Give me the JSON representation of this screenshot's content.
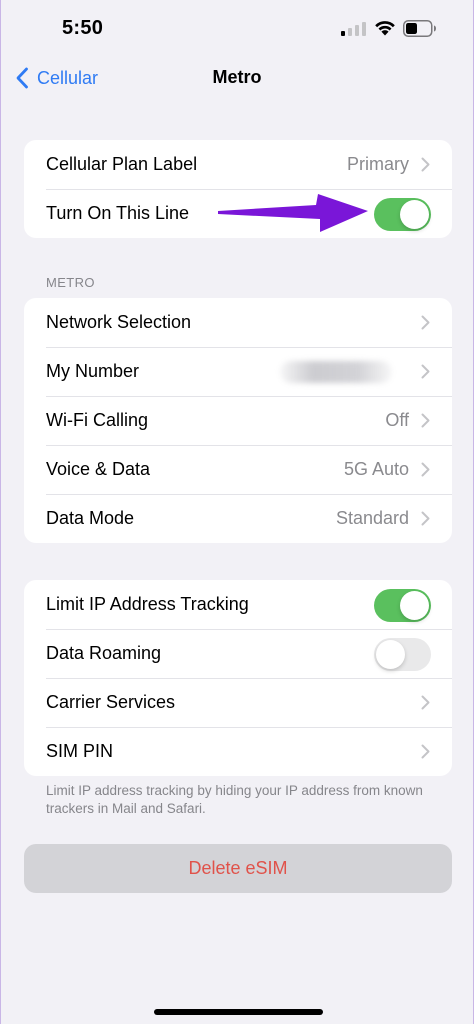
{
  "status_bar": {
    "time": "5:50",
    "icons": [
      "signal-icon",
      "wifi-icon",
      "battery-icon"
    ]
  },
  "nav": {
    "back_label": "Cellular",
    "title": "Metro"
  },
  "group1": {
    "rows": [
      {
        "label": "Cellular Plan Label",
        "value": "Primary"
      },
      {
        "label": "Turn On This Line",
        "toggle": true
      }
    ]
  },
  "section_header": "METRO",
  "group2": {
    "rows": [
      {
        "label": "Network Selection",
        "value": ""
      },
      {
        "label": "My Number",
        "value": ""
      },
      {
        "label": "Wi-Fi Calling",
        "value": "Off"
      },
      {
        "label": "Voice & Data",
        "value": "5G Auto"
      },
      {
        "label": "Data Mode",
        "value": "Standard"
      }
    ]
  },
  "group3": {
    "rows": [
      {
        "label": "Limit IP Address Tracking",
        "toggle": true
      },
      {
        "label": "Data Roaming",
        "toggle": false
      },
      {
        "label": "Carrier Services",
        "value": ""
      },
      {
        "label": "SIM PIN",
        "value": ""
      }
    ]
  },
  "footer_note": "Limit IP address tracking by hiding your IP address from known trackers in Mail and Safari.",
  "delete_label": "Delete eSIM",
  "colors": {
    "accent_blue": "#2f7bf4",
    "toggle_green": "#5ac05e",
    "destructive_red": "#e0524a",
    "annotation_purple": "#7a16d8",
    "background": "#f2f1f6"
  }
}
